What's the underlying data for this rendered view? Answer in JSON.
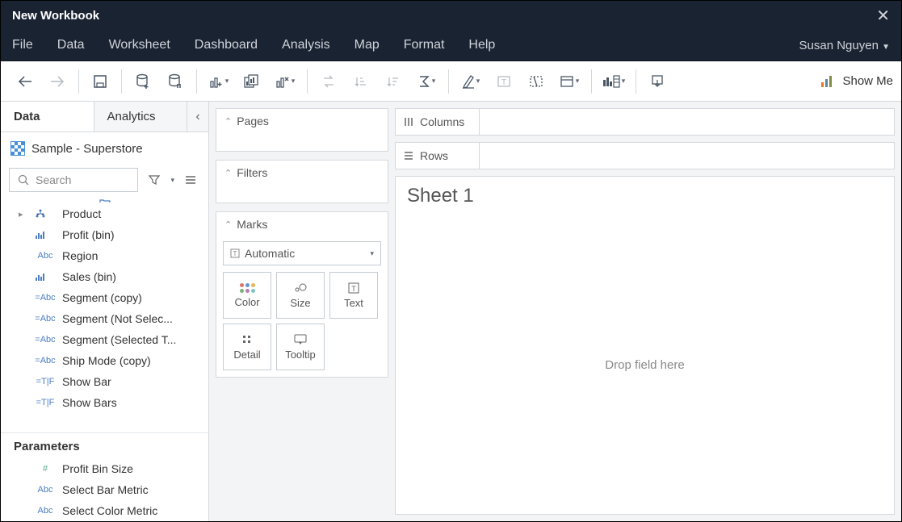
{
  "window": {
    "title": "New Workbook"
  },
  "menu": [
    "File",
    "Data",
    "Worksheet",
    "Dashboard",
    "Analysis",
    "Map",
    "Format",
    "Help"
  ],
  "user": "Susan Nguyen",
  "showme": "Show Me",
  "sidebar": {
    "tabs": {
      "data": "Data",
      "analytics": "Analytics"
    },
    "datasource": "Sample - Superstore",
    "search_placeholder": "Search",
    "fields": [
      {
        "icon": "hier",
        "label": "Product",
        "expandable": true
      },
      {
        "icon": "bar",
        "label": "Profit (bin)"
      },
      {
        "icon": "abc",
        "label": "Region"
      },
      {
        "icon": "bar",
        "label": "Sales (bin)"
      },
      {
        "icon": "eabc",
        "label": "Segment (copy)"
      },
      {
        "icon": "eabc",
        "label": "Segment (Not Selec..."
      },
      {
        "icon": "eabc",
        "label": "Segment (Selected T..."
      },
      {
        "icon": "eabc",
        "label": "Ship Mode (copy)"
      },
      {
        "icon": "etf",
        "label": "Show Bar"
      },
      {
        "icon": "etf",
        "label": "Show Bars"
      }
    ],
    "parameters_header": "Parameters",
    "parameters": [
      {
        "icon": "hash",
        "label": "Profit Bin Size"
      },
      {
        "icon": "abc",
        "label": "Select Bar Metric"
      },
      {
        "icon": "abc",
        "label": "Select Color Metric"
      }
    ]
  },
  "shelves": {
    "pages": "Pages",
    "filters": "Filters",
    "marks": "Marks",
    "marks_type": "Automatic",
    "mark_cells": [
      "Color",
      "Size",
      "Text",
      "Detail",
      "Tooltip"
    ],
    "columns": "Columns",
    "rows": "Rows"
  },
  "canvas": {
    "sheet_title": "Sheet 1",
    "drop_hint": "Drop field here"
  }
}
